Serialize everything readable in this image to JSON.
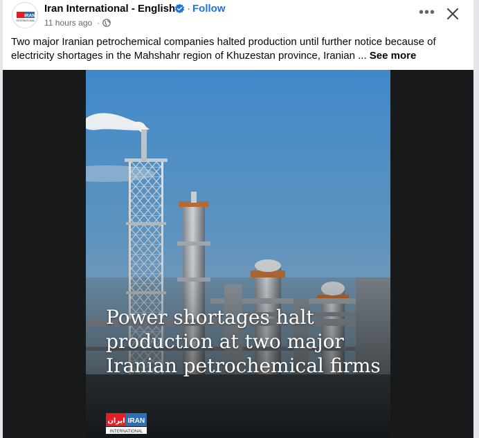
{
  "post": {
    "page_name": "Iran International - English",
    "follow_label": "Follow",
    "separator": "·",
    "time_ago": "11 hours ago",
    "meta_separator": "·",
    "visibility_icon": "globe-icon",
    "verified_icon": "verified-badge-icon",
    "more_icon": "more-options-icon",
    "more_label": "•••",
    "close_icon": "close-icon",
    "text": "Two major Iranian petrochemical companies halted production until further notice because of electricity shortages in the Mahshahr region of Khuzestan province, Iranian ...",
    "see_more_label": "See more"
  },
  "avatar": {
    "logo_text": "IRAN",
    "logo_sub": "INTERNATIONAL"
  },
  "media": {
    "headline_lines": [
      "Power shortages halt",
      "production at two major",
      "Iranian petrochemical firms"
    ],
    "logo_text": "IRAN",
    "logo_persian": "ایران",
    "logo_sub": "INTERNATIONAL"
  },
  "colors": {
    "link_blue": "#1b74e4",
    "brand_red": "#e31e24",
    "text_primary": "#050505",
    "text_secondary": "#65676b",
    "sky_top": "#3f88c9",
    "sky_bottom": "#a9cbe6"
  }
}
